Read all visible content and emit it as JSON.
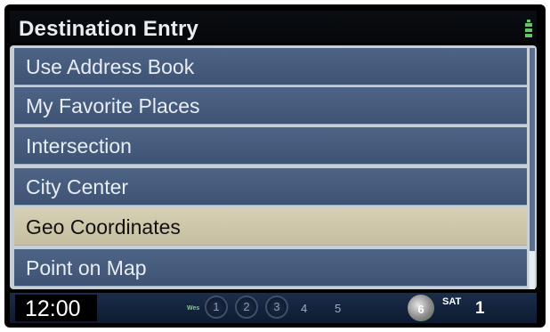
{
  "header": {
    "title": "Destination Entry",
    "status_icon": "signal-strength-icon"
  },
  "menu": {
    "items": [
      {
        "label": "Use Address Book",
        "selected": false
      },
      {
        "label": "My Favorite Places",
        "selected": false
      },
      {
        "label": "Intersection",
        "selected": false
      },
      {
        "label": "City Center",
        "selected": false
      },
      {
        "label": "Geo Coordinates",
        "selected": true
      },
      {
        "label": "Point on Map",
        "selected": false
      }
    ]
  },
  "status_bar": {
    "clock": "12:00",
    "source_label": "Wes",
    "presets": [
      "1",
      "2",
      "3",
      "4",
      "5",
      "6"
    ],
    "band": "SAT",
    "channel": "1"
  },
  "colors": {
    "row_bg": "#465b7d",
    "row_selected_bg": "#cfc8ab",
    "frame": "#c6ced8",
    "status_bg": "#13223d"
  }
}
